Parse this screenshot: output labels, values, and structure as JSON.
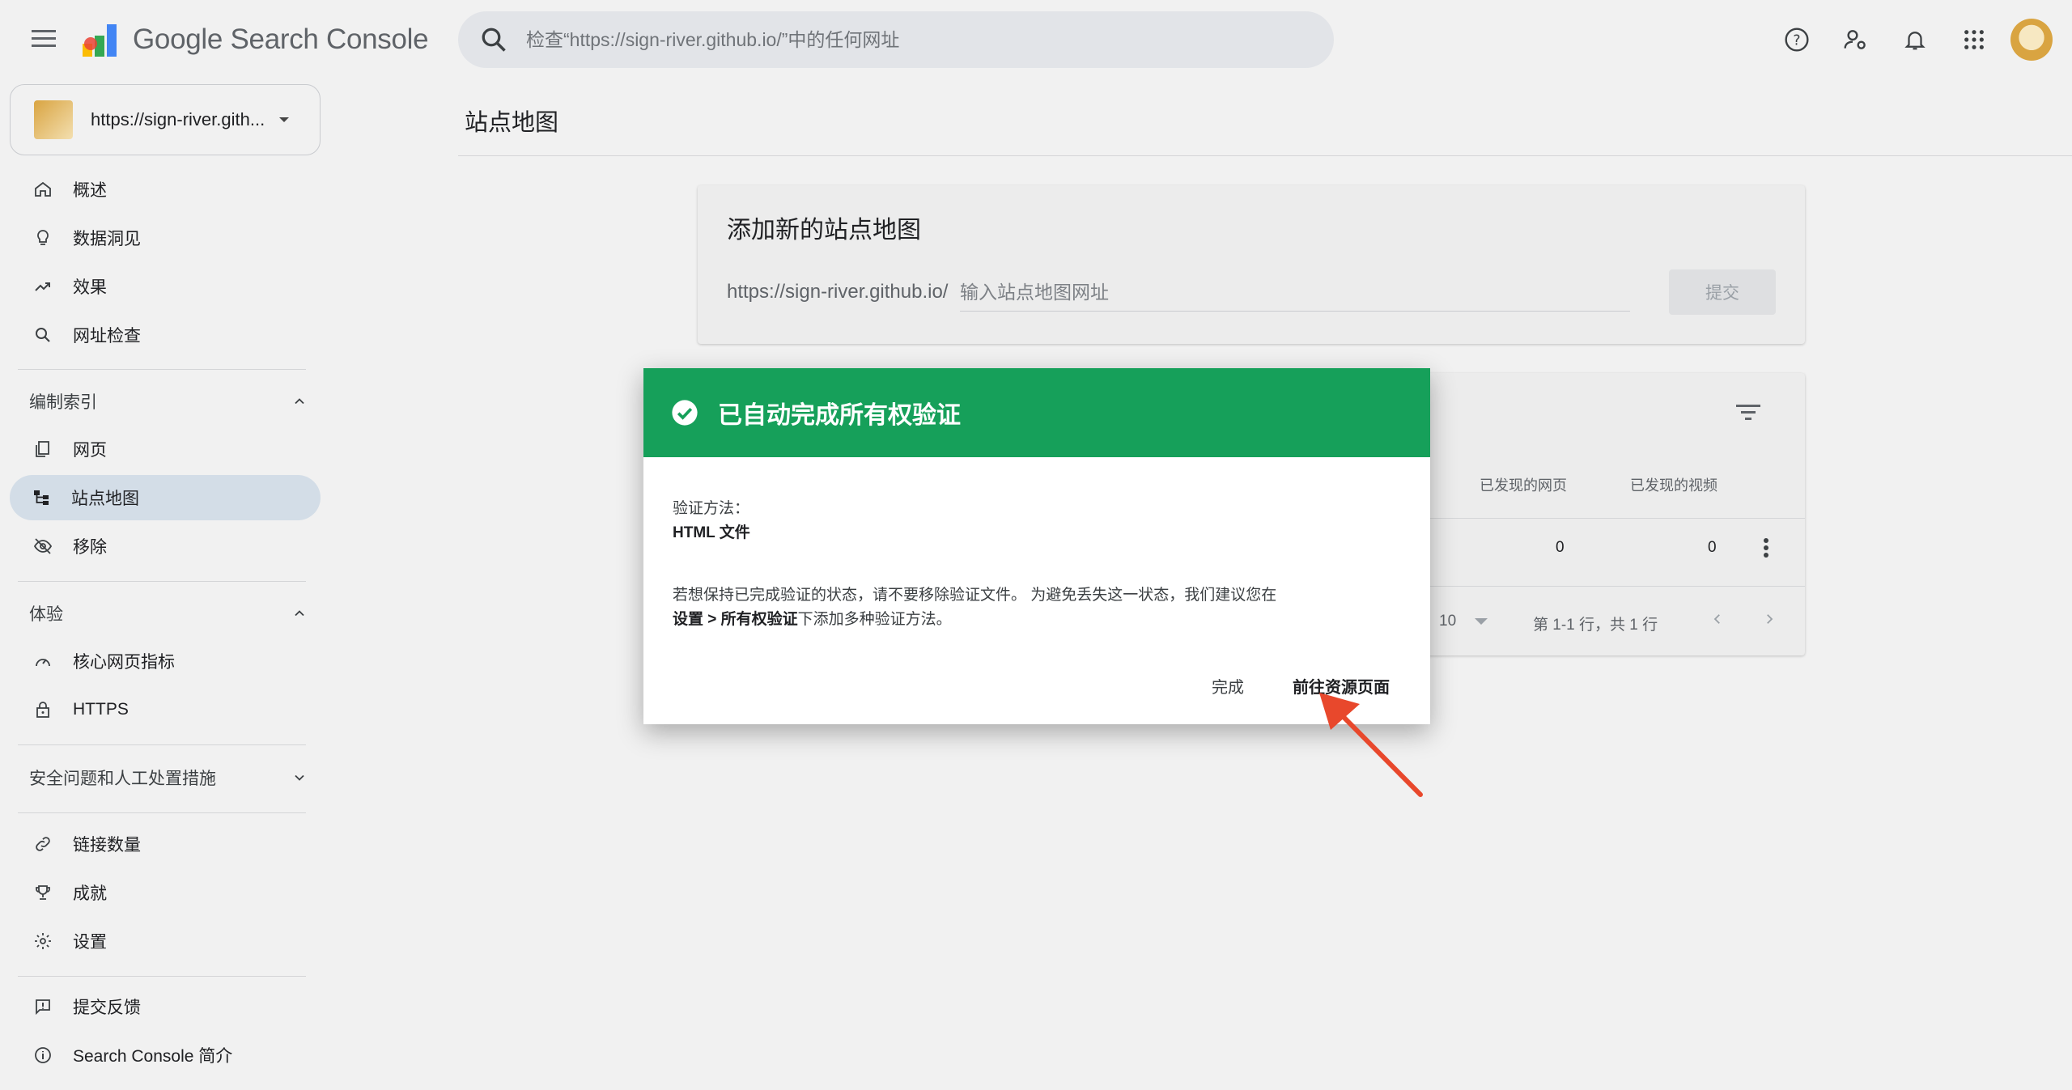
{
  "app": {
    "logo_text": "Google Search Console"
  },
  "search": {
    "placeholder": "检查“https://sign-river.github.io/”中的任何网址"
  },
  "property": {
    "url": "https://sign-river.gith..."
  },
  "nav": {
    "items": [
      {
        "label": "概述",
        "icon": "home-icon"
      },
      {
        "label": "数据洞见",
        "icon": "lightbulb-icon"
      },
      {
        "label": "效果",
        "icon": "trending-up-icon"
      },
      {
        "label": "网址检查",
        "icon": "search-icon"
      }
    ],
    "indexing": {
      "title": "编制索引",
      "items": [
        {
          "label": "网页",
          "icon": "pages-icon"
        },
        {
          "label": "站点地图",
          "icon": "sitemap-icon"
        },
        {
          "label": "移除",
          "icon": "visibility-off-icon"
        }
      ]
    },
    "experience": {
      "title": "体验",
      "items": [
        {
          "label": "核心网页指标",
          "icon": "speed-icon"
        },
        {
          "label": "HTTPS",
          "icon": "lock-icon"
        }
      ]
    },
    "security": {
      "title": "安全问题和人工处置措施"
    },
    "more": [
      {
        "label": "链接数量",
        "icon": "link-icon"
      },
      {
        "label": "成就",
        "icon": "trophy-icon"
      },
      {
        "label": "设置",
        "icon": "settings-icon"
      }
    ],
    "footer": [
      {
        "label": "提交反馈",
        "icon": "feedback-icon"
      },
      {
        "label": "Search Console 简介",
        "icon": "info-icon"
      }
    ]
  },
  "page": {
    "title": "站点地图"
  },
  "add_sitemap": {
    "title": "添加新的站点地图",
    "prefix": "https://sign-river.github.io/",
    "input_placeholder": "输入站点地图网址",
    "submit_label": "提交"
  },
  "sitemap_table": {
    "columns": [
      "已发现的网页",
      "已发现的视频"
    ],
    "rows": [
      {
        "pages": "0",
        "videos": "0"
      }
    ],
    "rows_per_page": "10",
    "pagination_text": "第 1-1 行，共 1 行"
  },
  "modal": {
    "title": "已自动完成所有权验证",
    "method_label": "验证方法：",
    "method_value": "HTML 文件",
    "note_line1": "若想保持已完成验证的状态，请不要移除验证文件。 为避免丢失这一状态，我们建议您在",
    "note_line2_bold": "设置 > 所有权验证",
    "note_line2_rest": "下添加多种验证方法。",
    "done_label": "完成",
    "goto_label": "前往资源页面"
  },
  "colors": {
    "modal_header": "#16a05a",
    "active_nav": "#d3dde7",
    "annotation_arrow": "#e8482c"
  }
}
